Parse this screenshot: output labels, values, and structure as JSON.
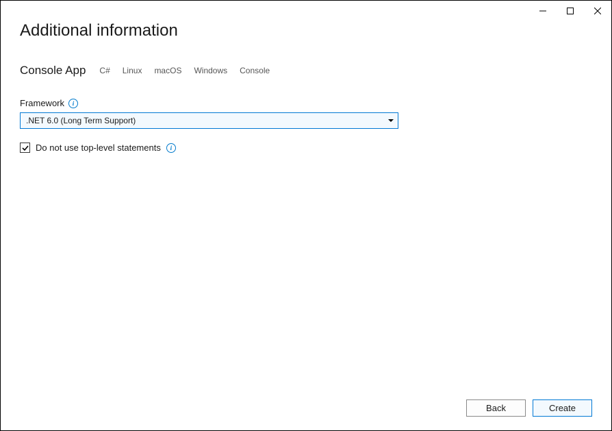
{
  "titlebar": {
    "minimize": "−",
    "maximize": "□",
    "close": "×"
  },
  "page": {
    "title": "Additional information",
    "projectType": "Console App",
    "tags": [
      "C#",
      "Linux",
      "macOS",
      "Windows",
      "Console"
    ]
  },
  "framework": {
    "label": "Framework",
    "selected": ".NET 6.0 (Long Term Support)"
  },
  "checkbox": {
    "label": "Do not use top-level statements",
    "checked": true
  },
  "footer": {
    "back": "Back",
    "create": "Create"
  }
}
